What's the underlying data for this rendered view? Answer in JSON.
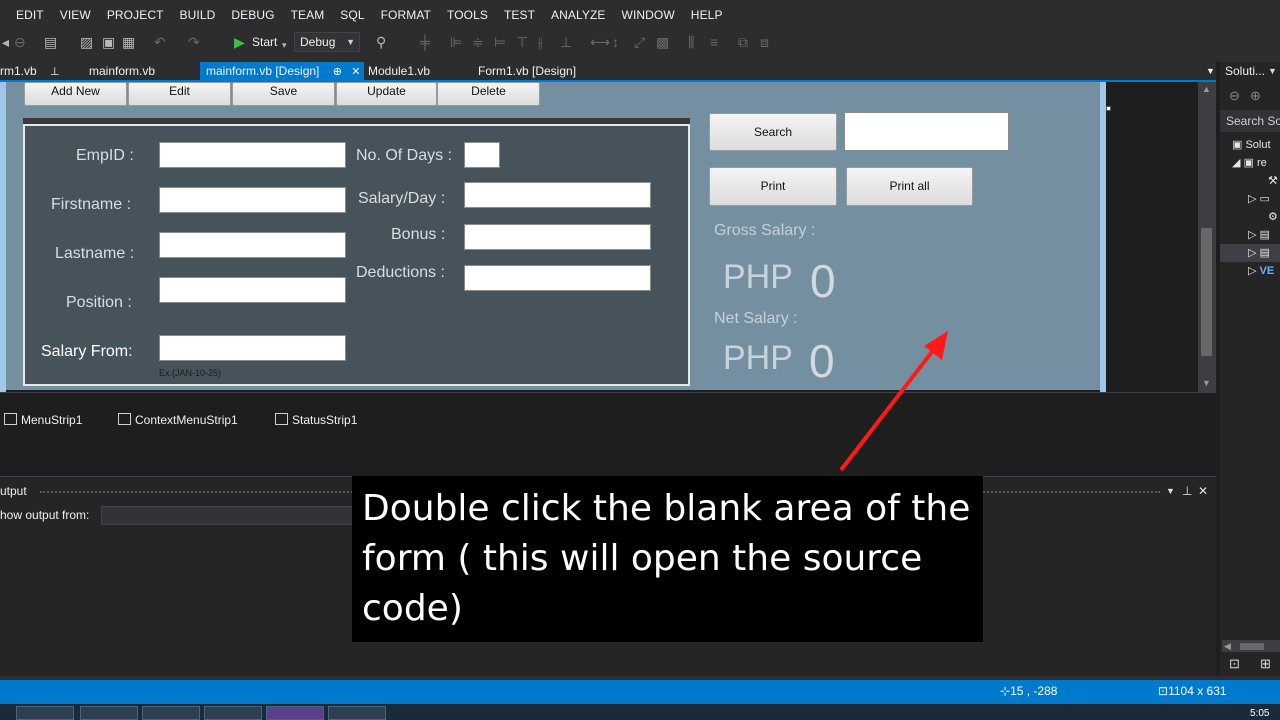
{
  "menu": [
    "EDIT",
    "VIEW",
    "PROJECT",
    "BUILD",
    "DEBUG",
    "TEAM",
    "SQL",
    "FORMAT",
    "TOOLS",
    "TEST",
    "ANALYZE",
    "WINDOW",
    "HELP"
  ],
  "toolbar": {
    "start_label": "Start",
    "config_value": "Debug"
  },
  "tabs": [
    {
      "label": "rm1.vb",
      "pin": "📌"
    },
    {
      "label": "mainform.vb"
    },
    {
      "label": "mainform.vb [Design]",
      "pin": "⊕",
      "close": "✕"
    },
    {
      "label": "Module1.vb"
    },
    {
      "label": "Form1.vb [Design]"
    }
  ],
  "form": {
    "buttons": {
      "add_new": "Add New",
      "edit": "Edit",
      "save": "Save",
      "update": "Update",
      "delete": "Delete",
      "search": "Search",
      "print": "Print",
      "print_all": "Print all"
    },
    "labels": {
      "empid": "EmpID :",
      "firstname": "Firstname :",
      "lastname": "Lastname :",
      "position": "Position :",
      "salary_from": "Salary From:",
      "date_hint": "Ex.(JAN-10-25)",
      "no_of_days": "No. Of Days :",
      "salary_day": "Salary/Day :",
      "bonus": "Bonus :",
      "deductions": "Deductions :",
      "gross_salary": "Gross Salary :",
      "net_salary": "Net Salary :",
      "gross_currency": "PHP",
      "gross_value": "0",
      "net_currency": "PHP",
      "net_value": "0"
    }
  },
  "tray": [
    "MenuStrip1",
    "ContextMenuStrip1",
    "StatusStrip1"
  ],
  "output": {
    "title": "utput",
    "show_from": "how output from:"
  },
  "solution": {
    "title": "Soluti...",
    "search": "Search Solu",
    "root": "Solut",
    "project": "re",
    "last": "VE"
  },
  "annotation": {
    "text": "Double click the blank area of the form ( this will open the source code)",
    "arrow_color": "#ff1a1a"
  },
  "status": {
    "position": "15 , -288",
    "size": "1104 x 631"
  },
  "clock": "5:05"
}
